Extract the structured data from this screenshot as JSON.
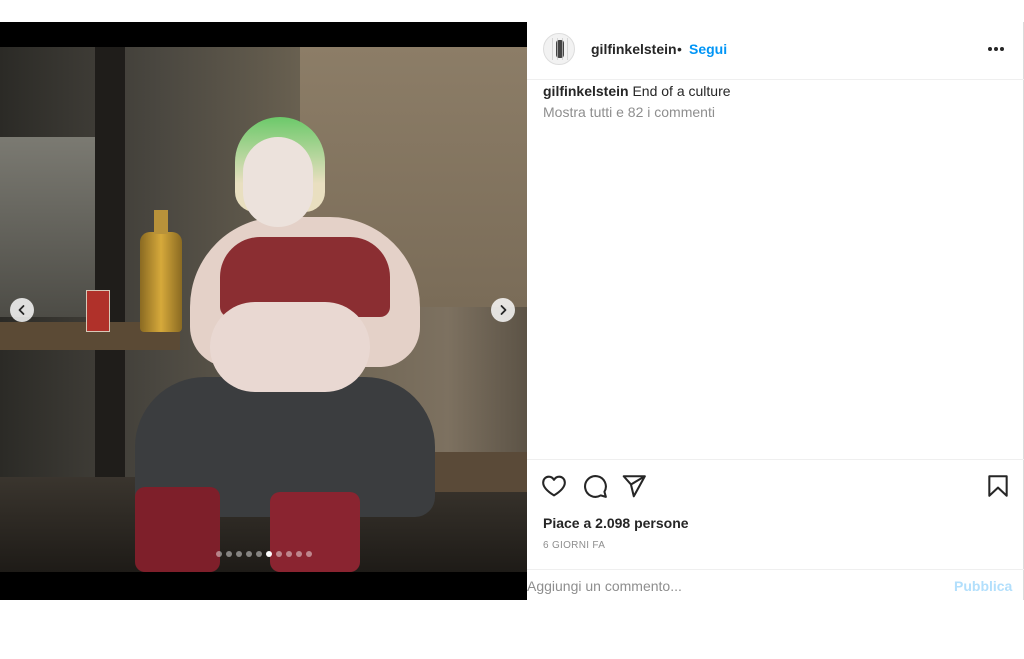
{
  "post": {
    "author": {
      "username": "gilfinkelstein",
      "separator": "•",
      "follow_label": "Segui"
    },
    "caption": {
      "username": "gilfinkelstein",
      "text": "End of a culture"
    },
    "view_comments_label": "Mostra tutti e 82 i commenti",
    "likes_label": "Piace a 2.098 persone",
    "timestamp": "6 GIORNI FA",
    "comment_placeholder": "Aggiungi un commento...",
    "publish_label": "Pubblica",
    "carousel": {
      "total": 10,
      "current": 6
    }
  },
  "icons": {
    "more": "more-options-icon",
    "like": "heart-icon",
    "comment": "comment-bubble-icon",
    "share": "paper-plane-icon",
    "save": "bookmark-icon",
    "prev": "chevron-left-icon",
    "next": "chevron-right-icon"
  },
  "colors": {
    "accent": "#0095f6",
    "publish_disabled": "#b2dffc",
    "secondary_text": "#8e8e8e"
  }
}
